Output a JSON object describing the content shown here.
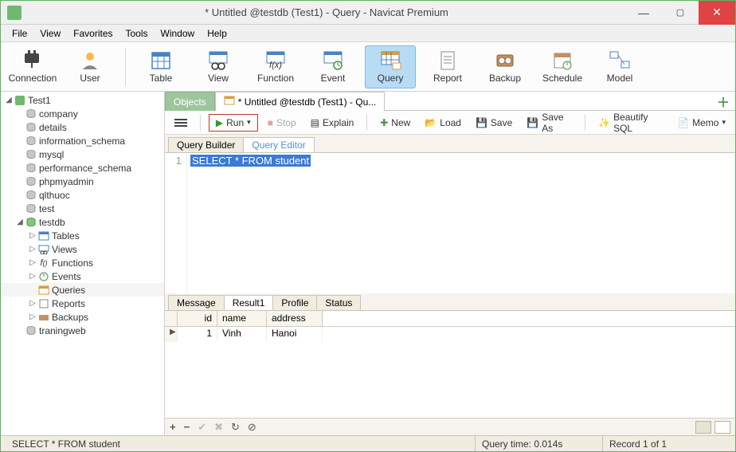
{
  "window": {
    "title": "* Untitled @testdb (Test1) - Query - Navicat Premium"
  },
  "menu": [
    "File",
    "View",
    "Favorites",
    "Tools",
    "Window",
    "Help"
  ],
  "toolbar": {
    "connection": "Connection",
    "user": "User",
    "table": "Table",
    "view": "View",
    "function": "Function",
    "event": "Event",
    "query": "Query",
    "report": "Report",
    "backup": "Backup",
    "schedule": "Schedule",
    "model": "Model"
  },
  "tree": {
    "connection": "Test1",
    "dbs": [
      "company",
      "details",
      "information_schema",
      "mysql",
      "performance_schema",
      "phpmyadmin",
      "qlthuoc",
      "test"
    ],
    "open_db": "testdb",
    "nodes": [
      "Tables",
      "Views",
      "Functions",
      "Events",
      "Queries",
      "Reports",
      "Backups"
    ],
    "last_db": "traningweb"
  },
  "tabs": {
    "objects": "Objects",
    "query_tab": "* Untitled @testdb (Test1) - Qu..."
  },
  "query_toolbar": {
    "run": "Run",
    "stop": "Stop",
    "explain": "Explain",
    "new": "New",
    "load": "Load",
    "save": "Save",
    "save_as": "Save As",
    "beautify": "Beautify SQL",
    "memo": "Memo"
  },
  "subtabs": {
    "builder": "Query Builder",
    "editor": "Query Editor"
  },
  "sql": "SELECT * FROM student",
  "result_tabs": [
    "Message",
    "Result1",
    "Profile",
    "Status"
  ],
  "columns": [
    "id",
    "name",
    "address"
  ],
  "rows": [
    {
      "id": "1",
      "name": "Vinh",
      "address": "Hanoi"
    }
  ],
  "status": {
    "sql": "SELECT * FROM student",
    "time": "Query time: 0.014s",
    "record": "Record 1 of 1"
  },
  "line_no": "1"
}
